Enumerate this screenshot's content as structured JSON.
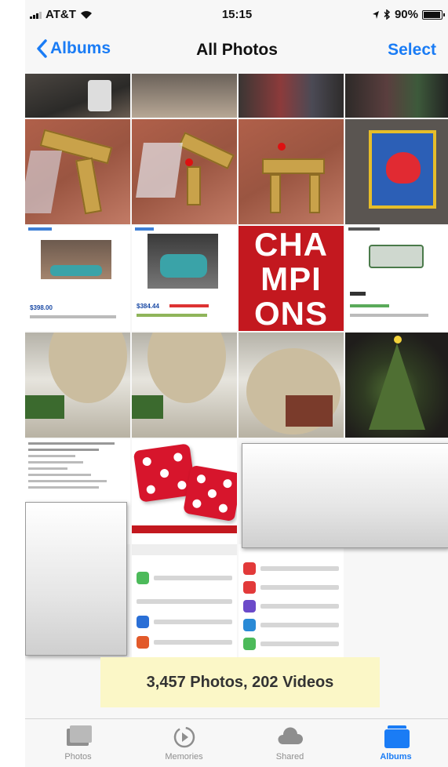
{
  "status_bar": {
    "carrier": "AT&T",
    "time": "15:15",
    "battery": "90%",
    "battery_level": 0.9
  },
  "nav": {
    "back_label": "Albums",
    "title": "All Photos",
    "select_label": "Select"
  },
  "tiles": {
    "champions_lines": [
      "CHA",
      "MPI",
      "ONS"
    ],
    "ad_1_price": "$398.00",
    "ad_2_price": "$384.44"
  },
  "photo_count": "3,457 Photos, 202 Videos",
  "tabbar": {
    "tabs": [
      {
        "label": "Photos",
        "icon": "photos-icon",
        "active": false
      },
      {
        "label": "Memories",
        "icon": "memories-icon",
        "active": false
      },
      {
        "label": "Shared",
        "icon": "shared-icon",
        "active": false
      },
      {
        "label": "Albums",
        "icon": "albums-icon",
        "active": true
      }
    ]
  },
  "colors": {
    "accent": "#1a7cf5",
    "count_highlight": "#fbf7c7"
  }
}
